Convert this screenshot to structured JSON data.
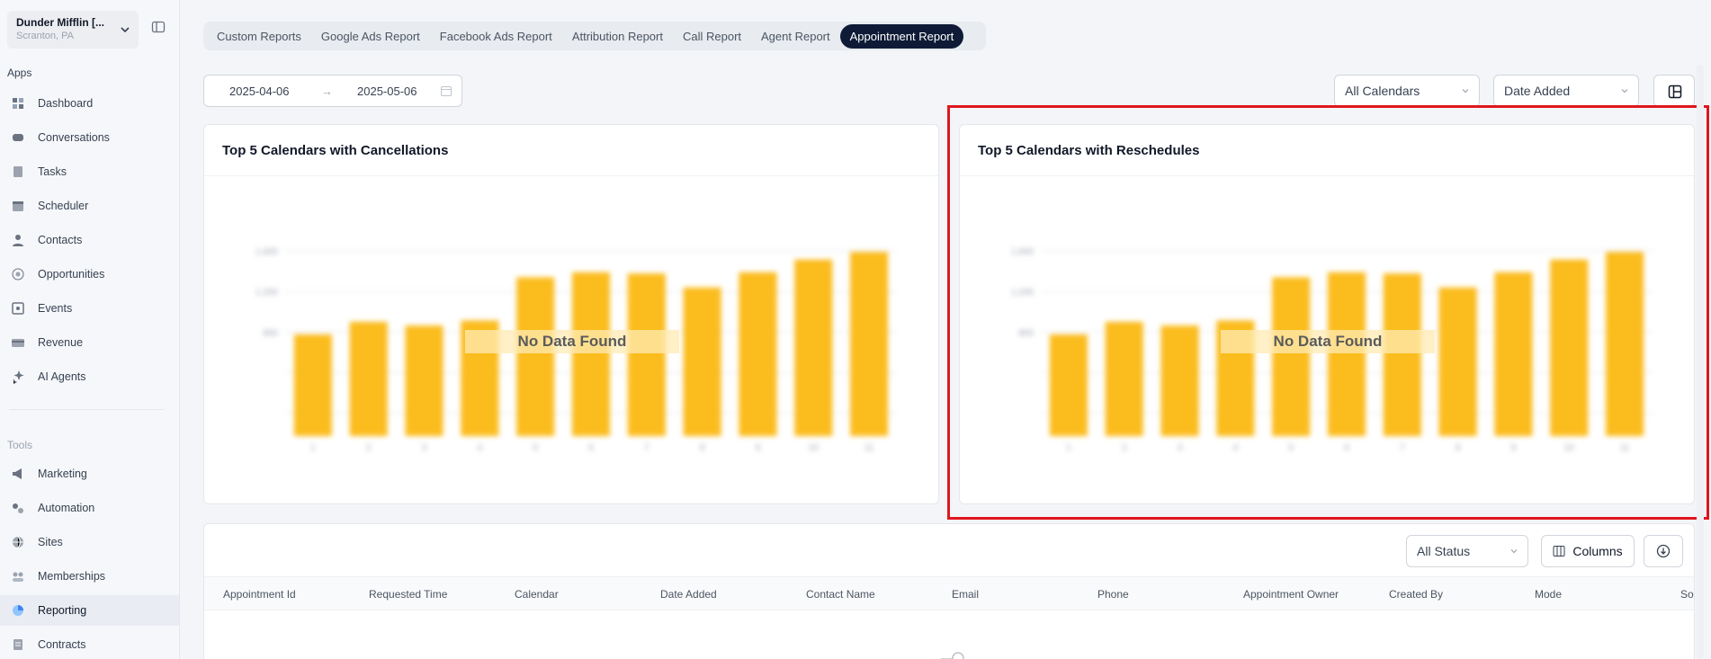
{
  "location": {
    "name": "Dunder Mifflin [...",
    "sub": "Scranton, PA"
  },
  "sidebar": {
    "apps_label": "Apps",
    "tools_label": "Tools",
    "apps": [
      {
        "label": "Dashboard",
        "icon": "dashboard-icon"
      },
      {
        "label": "Conversations",
        "icon": "chat-icon"
      },
      {
        "label": "Tasks",
        "icon": "tasks-icon"
      },
      {
        "label": "Scheduler",
        "icon": "calendar-icon"
      },
      {
        "label": "Contacts",
        "icon": "person-icon"
      },
      {
        "label": "Opportunities",
        "icon": "opportunities-icon"
      },
      {
        "label": "Events",
        "icon": "events-icon"
      },
      {
        "label": "Revenue",
        "icon": "card-icon"
      },
      {
        "label": "AI Agents",
        "icon": "sparkle-icon"
      }
    ],
    "tools": [
      {
        "label": "Marketing",
        "icon": "megaphone-icon"
      },
      {
        "label": "Automation",
        "icon": "gears-icon"
      },
      {
        "label": "Sites",
        "icon": "globe-icon"
      },
      {
        "label": "Memberships",
        "icon": "members-icon"
      },
      {
        "label": "Reporting",
        "icon": "pie-icon",
        "active": true
      },
      {
        "label": "Contracts",
        "icon": "document-icon"
      }
    ]
  },
  "tabs": [
    "Custom Reports",
    "Google Ads Report",
    "Facebook Ads Report",
    "Attribution Report",
    "Call Report",
    "Agent Report",
    "Appointment Report"
  ],
  "active_tab": "Appointment Report",
  "date_range": {
    "start": "2025-04-06",
    "arrow": "→",
    "end": "2025-05-06"
  },
  "filters": {
    "calendars": "All Calendars",
    "date_type": "Date Added"
  },
  "cards": [
    {
      "title": "Top 5 Calendars with Cancellations",
      "empty_text": "No Data Found"
    },
    {
      "title": "Top 5 Calendars with Reschedules",
      "empty_text": "No Data Found"
    }
  ],
  "chart_data": [
    {
      "type": "bar",
      "categories": [
        "1",
        "2",
        "3",
        "4",
        "5",
        "6",
        "7",
        "8",
        "9",
        "10",
        "11"
      ],
      "values": [
        800,
        900,
        870,
        910,
        1250,
        1290,
        1280,
        1170,
        1290,
        1390,
        1450
      ],
      "ylim": [
        0,
        1600
      ],
      "yticks": [
        "",
        "",
        "800",
        "1,200",
        "1,600"
      ],
      "title": "Top 5 Calendars with Cancellations",
      "grid": true,
      "color": "#fbbc1d"
    },
    {
      "type": "bar",
      "categories": [
        "1",
        "2",
        "3",
        "4",
        "5",
        "6",
        "7",
        "8",
        "9",
        "10",
        "11"
      ],
      "values": [
        800,
        900,
        870,
        910,
        1250,
        1290,
        1280,
        1170,
        1290,
        1390,
        1450
      ],
      "ylim": [
        0,
        1600
      ],
      "yticks": [
        "",
        "",
        "800",
        "1,200",
        "1,600"
      ],
      "title": "Top 5 Calendars with Reschedules",
      "grid": true,
      "color": "#fbbc1d"
    }
  ],
  "table": {
    "status_filter": "All Status",
    "columns_button": "Columns",
    "headers": [
      "Appointment Id",
      "Requested Time",
      "Calendar",
      "Date Added",
      "Contact Name",
      "Email",
      "Phone",
      "Appointment Owner",
      "Created By",
      "Mode",
      "So"
    ]
  }
}
